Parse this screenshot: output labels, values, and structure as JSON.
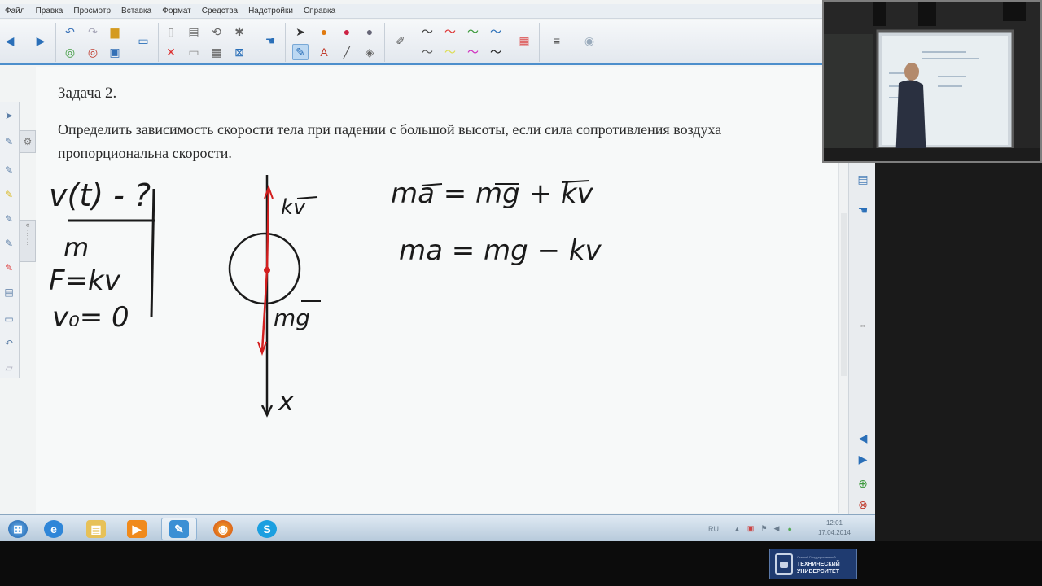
{
  "menu": {
    "items": [
      "Файл",
      "Правка",
      "Просмотр",
      "Вставка",
      "Формат",
      "Средства",
      "Надстройки",
      "Справка"
    ]
  },
  "toolbar": {
    "icons": [
      "back-arrow-icon",
      "forward-arrow-icon",
      "undo-icon",
      "redo-icon",
      "folder-icon",
      "screen-icon",
      "page-icon",
      "insert-page-icon",
      "crop-icon",
      "screen-capture-icon",
      "select-pointer-icon",
      "pen-icon",
      "eraser-icon",
      "line-icon",
      "text-icon",
      "fill-icon",
      "color-palette-icon",
      "properties-icon"
    ]
  },
  "task": {
    "title": "Задача 2.",
    "text": "Определить зависимость скорости тела при падении с большой высоты, если сила сопротивления воздуха пропорциональна скорости."
  },
  "whiteboard": {
    "given": {
      "find": "v(t) - ?",
      "mass": "m",
      "force": "F=kv",
      "initial_velocity": "v₀= 0"
    },
    "diagram": {
      "drag_label": "kv",
      "gravity_label": "mg",
      "axis_label": "x"
    },
    "equations": {
      "vector_form": "ma = mg + kv",
      "scalar_form": "ma = mg − kv"
    }
  },
  "taskbar": {
    "apps": [
      "windows-start-icon",
      "internet-explorer-icon",
      "file-explorer-icon",
      "media-player-icon",
      "smart-notebook-icon",
      "firefox-icon",
      "skype-icon"
    ],
    "language": "RU",
    "time": "12:01",
    "date": "17.04.2014"
  },
  "logo": {
    "line1": "Омский Государственный",
    "line2": "ТЕХНИЧЕСКИЙ",
    "line3": "УНИВЕРСИТЕТ"
  },
  "colors": {
    "accent": "#4d8fcc",
    "annotation_red": "#d32020",
    "ink": "#1a1a1a"
  }
}
